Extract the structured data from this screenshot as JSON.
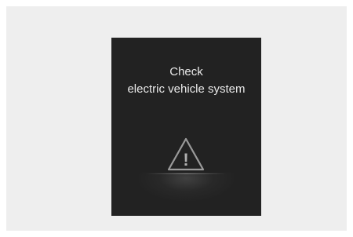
{
  "message": {
    "line1": "Check",
    "line2": "electric vehicle system"
  },
  "icon": {
    "name": "warning-triangle-icon",
    "glyph": "!"
  },
  "colors": {
    "background": "#eeeeee",
    "display": "#222222",
    "text": "#e9e9e9",
    "icon_stroke": "#9a9a9a"
  }
}
